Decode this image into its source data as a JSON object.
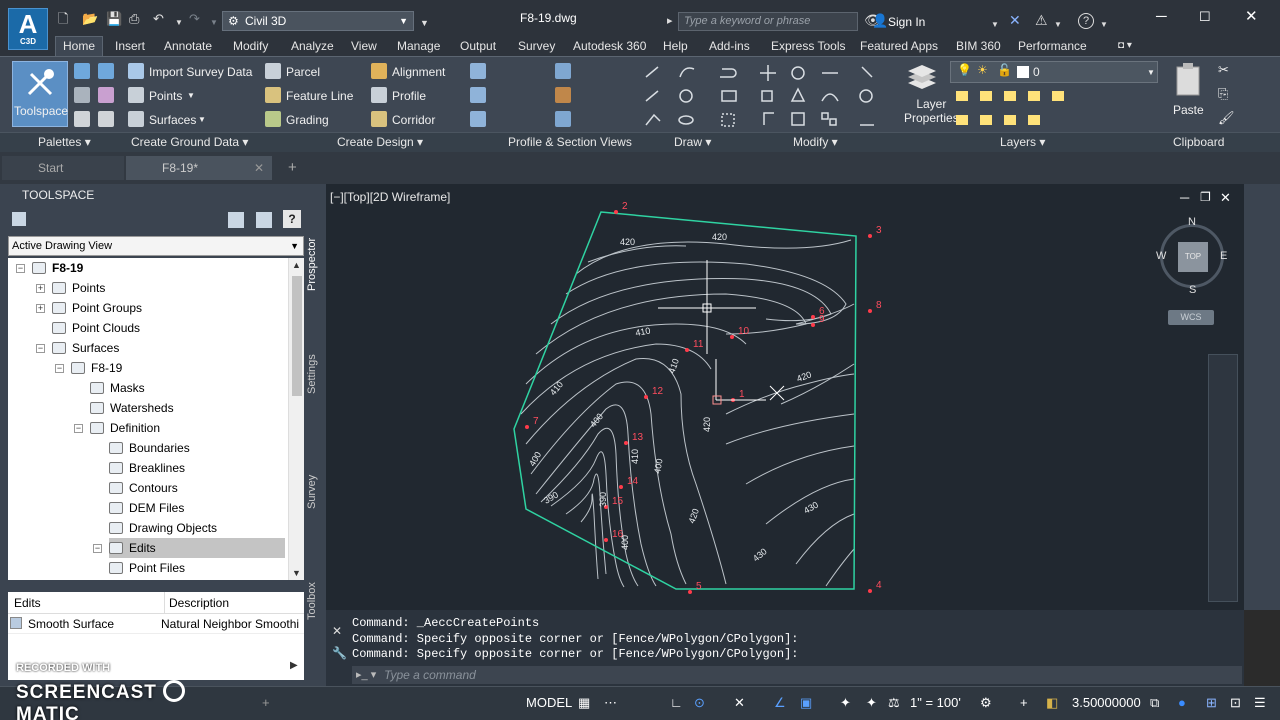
{
  "app": {
    "logo_text": "A",
    "logo_sub": "C3D",
    "workspace": "Civil 3D",
    "document_title": "F8-19.dwg",
    "search_placeholder": "Type a keyword or phrase",
    "sign_in": "Sign In"
  },
  "ribbon_tabs": [
    "Home",
    "Insert",
    "Annotate",
    "Modify",
    "Analyze",
    "View",
    "Manage",
    "Output",
    "Survey",
    "Autodesk 360",
    "Help",
    "Add-ins",
    "Express Tools",
    "Featured Apps",
    "BIM 360",
    "Performance"
  ],
  "ribbon": {
    "toolspace": "Toolspace",
    "ground": [
      "Import Survey Data",
      "Points",
      "Surfaces"
    ],
    "design_left": [
      "Parcel",
      "Feature Line",
      "Grading"
    ],
    "design_right": [
      "Alignment",
      "Profile",
      "Corridor"
    ],
    "layer_properties": "Layer\nProperties",
    "layer_current": "0",
    "paste": "Paste",
    "panels": [
      "Palettes",
      "Create Ground Data",
      "Create Design",
      "Profile & Section Views",
      "Draw",
      "Modify",
      "Layers",
      "Clipboard"
    ]
  },
  "doc_tabs": [
    "Start",
    "F8-19*"
  ],
  "toolspace": {
    "title": "TOOLSPACE",
    "view": "Active Drawing View",
    "tree": [
      {
        "label": "F8-19",
        "bold": true
      },
      {
        "label": "Points"
      },
      {
        "label": "Point Groups"
      },
      {
        "label": "Point Clouds"
      },
      {
        "label": "Surfaces"
      },
      {
        "label": "F8-19"
      },
      {
        "label": "Masks"
      },
      {
        "label": "Watersheds"
      },
      {
        "label": "Definition"
      },
      {
        "label": "Boundaries"
      },
      {
        "label": "Breaklines"
      },
      {
        "label": "Contours"
      },
      {
        "label": "DEM Files"
      },
      {
        "label": "Drawing Objects"
      },
      {
        "label": "Edits"
      },
      {
        "label": "Point Files"
      }
    ],
    "side_tabs": [
      "Prospector",
      "Settings",
      "Survey",
      "Toolbox"
    ],
    "edits_table": {
      "col1": "Edits",
      "col2": "Description",
      "row": {
        "edit": "Smooth Surface",
        "description": "Natural Neighbor Smoothi"
      }
    }
  },
  "viewport": {
    "label": "[−][Top][2D Wireframe]",
    "viewcube": {
      "N": "N",
      "S": "S",
      "E": "E",
      "W": "W",
      "top": "TOP",
      "wcs": "WCS"
    },
    "point_labels": [
      "2",
      "3",
      "8",
      "9",
      "10",
      "11",
      "1",
      "12",
      "13",
      "14",
      "16",
      "7",
      "5",
      "4",
      "6",
      "15"
    ],
    "contour_labels": [
      "420",
      "420",
      "410",
      "410",
      "410",
      "420",
      "400",
      "400",
      "410",
      "400",
      "390",
      "390",
      "400",
      "420",
      "420",
      "430",
      "430"
    ]
  },
  "command": {
    "lines": [
      "Command: _AeccCreatePoints",
      "Command: Specify opposite corner or [Fence/WPolygon/CPolygon]:",
      "Command: Specify opposite corner or [Fence/WPolygon/CPolygon]:"
    ],
    "placeholder": "Type a command"
  },
  "status": {
    "model": "MODEL",
    "scale": "1\" = 100'",
    "coord": "3.50000000"
  },
  "watermark": {
    "recorded": "RECORDED WITH",
    "brand": "SCREENCAST",
    "brand2": "MATIC"
  }
}
